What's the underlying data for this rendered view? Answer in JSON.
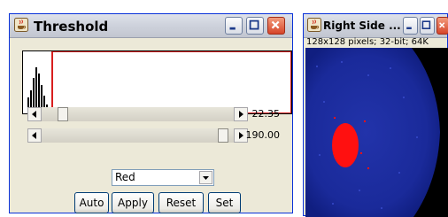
{
  "threshold_window": {
    "title": "Threshold",
    "buttons": {
      "minimize": "minimize",
      "maximize": "maximize",
      "close": "close"
    },
    "min_slider": {
      "value_text": "22.35",
      "fraction": 0.09
    },
    "max_slider": {
      "value_text": "190.00",
      "fraction": 0.97
    },
    "lut_select": {
      "selected": "Red"
    },
    "actions": {
      "auto": "Auto",
      "apply": "Apply",
      "reset": "Reset",
      "set": "Set"
    },
    "colors": {
      "threshold_line": "#d81e1e"
    }
  },
  "right_side_window": {
    "title": "Right Side ...",
    "info": "128x128 pixels; 32-bit; 64K",
    "colors": {
      "background": "#000000",
      "field": "#1a2a9a",
      "highlight": "#ff1010"
    }
  }
}
